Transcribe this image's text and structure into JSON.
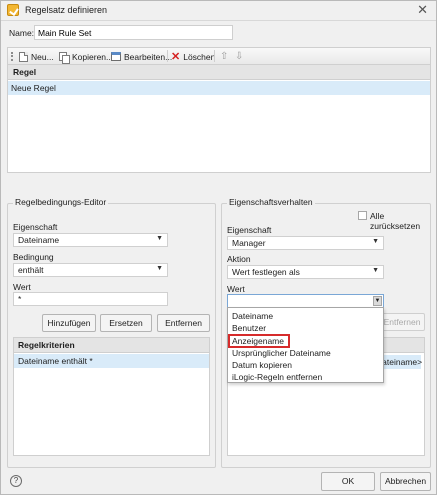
{
  "window": {
    "title": "Regelsatz definieren"
  },
  "name": {
    "label": "Name:",
    "value": "Main Rule Set"
  },
  "toolbar": {
    "new_label": "Neu...",
    "copy_label": "Kopieren...",
    "edit_label": "Bearbeiten...",
    "delete_label": "Löschen"
  },
  "rules": {
    "header": "Regel",
    "rows": [
      "Neue Regel"
    ]
  },
  "condition_editor": {
    "group_label": "Regelbedingungs-Editor",
    "property_label": "Eigenschaft",
    "property_value": "Dateiname",
    "condition_label": "Bedingung",
    "condition_value": "enthält",
    "value_label": "Wert",
    "value_value": "*",
    "add_button": "Hinzufügen",
    "replace_button": "Ersetzen",
    "remove_button": "Entfernen",
    "criteria_header": "Regelkriterien",
    "criteria_rows": [
      "Dateiname enthält *"
    ]
  },
  "property_behavior": {
    "group_label": "Eigenschaftsverhalten",
    "reset_all_label": "Alle zurücksetzen",
    "property_label": "Eigenschaft",
    "property_value": "Manager",
    "action_label": "Aktion",
    "action_value": "Wert festlegen als",
    "value_label": "Wert",
    "value_value": "",
    "remove_button": "Entfernen",
    "row_tail": "Dateiname>"
  },
  "value_dropdown": {
    "options": [
      "Dateiname",
      "Benutzer",
      "Anzeigename",
      "Ursprünglicher Dateiname",
      "Datum kopieren",
      "iLogic-Regeln entfernen"
    ],
    "highlighted": "Anzeigename"
  },
  "footer": {
    "ok_label": "OK",
    "cancel_label": "Abbrechen"
  },
  "colors": {
    "selection": "#d9ebf9",
    "highlight_border": "#d62b2b"
  }
}
